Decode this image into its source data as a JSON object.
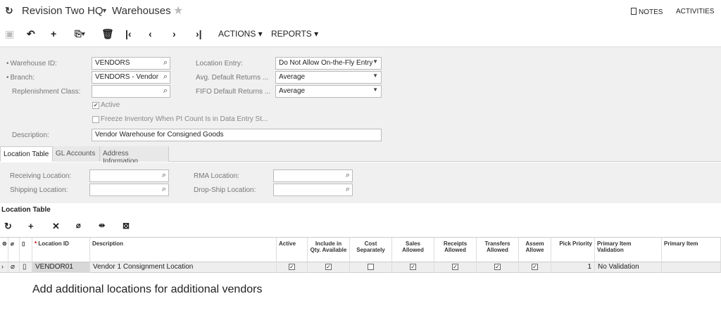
{
  "header": {
    "company": "Revision Two HQ",
    "screen": "Warehouses",
    "notes": "NOTES",
    "activities": "ACTIVITIES"
  },
  "toolbar": {
    "actions": "ACTIONS",
    "reports": "REPORTS"
  },
  "form": {
    "warehouse_id_label": "Warehouse ID:",
    "warehouse_id_value": "VENDORS",
    "branch_label": "Branch:",
    "branch_value": "VENDORS - Vendor",
    "replenishment_label": "Replenishment Class:",
    "replenishment_value": "",
    "location_entry_label": "Location Entry:",
    "location_entry_value": "Do Not Allow On-the-Fly Entry",
    "avg_returns_label": "Avg. Default Returns ...",
    "avg_returns_value": "Average",
    "fifo_returns_label": "FIFO Default Returns ...",
    "fifo_returns_value": "Average",
    "active_label": "Active",
    "freeze_label": "Freeze Inventory When PI Count Is in Data Entry St...",
    "description_label": "Description:",
    "description_value": "Vendor Warehouse for Consigned Goods"
  },
  "tabs": [
    "Location Table",
    "GL Accounts",
    "Address Information"
  ],
  "locations": {
    "receiving_label": "Receiving Location:",
    "shipping_label": "Shipping Location:",
    "rma_label": "RMA Location:",
    "dropship_label": "Drop-Ship Location:"
  },
  "grid": {
    "title": "Location Table",
    "headers": {
      "location_id": "Location ID",
      "description": "Description",
      "active": "Active",
      "include_qty": "Include in Qty. Available",
      "cost_sep": "Cost Separately",
      "sales": "Sales Allowed",
      "receipts": "Receipts Allowed",
      "transfers": "Transfers Allowed",
      "assem": "Assem Allowe",
      "pick": "Pick Priority",
      "primary_validation": "Primary Item Validation",
      "primary_item": "Primary Item"
    },
    "row": {
      "location_id": "VENDOR01",
      "description": "Vendor 1 Consignment Location",
      "pick": "1",
      "validation": "No Validation"
    }
  },
  "caption": "Add additional locations for additional vendors"
}
